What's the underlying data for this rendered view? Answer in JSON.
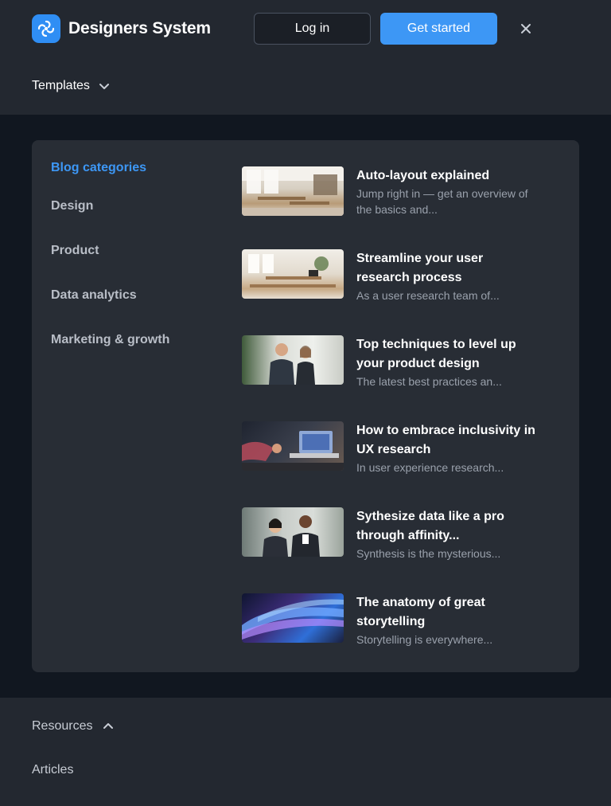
{
  "header": {
    "brand": "Designers System",
    "login_label": "Log in",
    "get_started_label": "Get started",
    "accent_color": "#3d97f5"
  },
  "nav": {
    "templates_label": "Templates"
  },
  "blog": {
    "heading": "Blog categories",
    "categories": [
      "Design",
      "Product",
      "Data analytics",
      "Marketing & growth"
    ],
    "posts": [
      {
        "title": "Auto-layout explained",
        "excerpt": "Jump right in — get an overview of the basics and..."
      },
      {
        "title": "Streamline your user research process",
        "excerpt": "As a user research team of..."
      },
      {
        "title": "Top techniques to level up your product design",
        "excerpt": "The latest best practices an..."
      },
      {
        "title": "How to embrace inclusivity in UX research",
        "excerpt": "In user experience research..."
      },
      {
        "title": "Sythesize data like a pro through affinity...",
        "excerpt": "Synthesis is the mysterious..."
      },
      {
        "title": "The anatomy of great storytelling",
        "excerpt": "Storytelling is everywhere..."
      }
    ]
  },
  "footer": {
    "resources_label": "Resources",
    "articles_label": "Articles"
  }
}
